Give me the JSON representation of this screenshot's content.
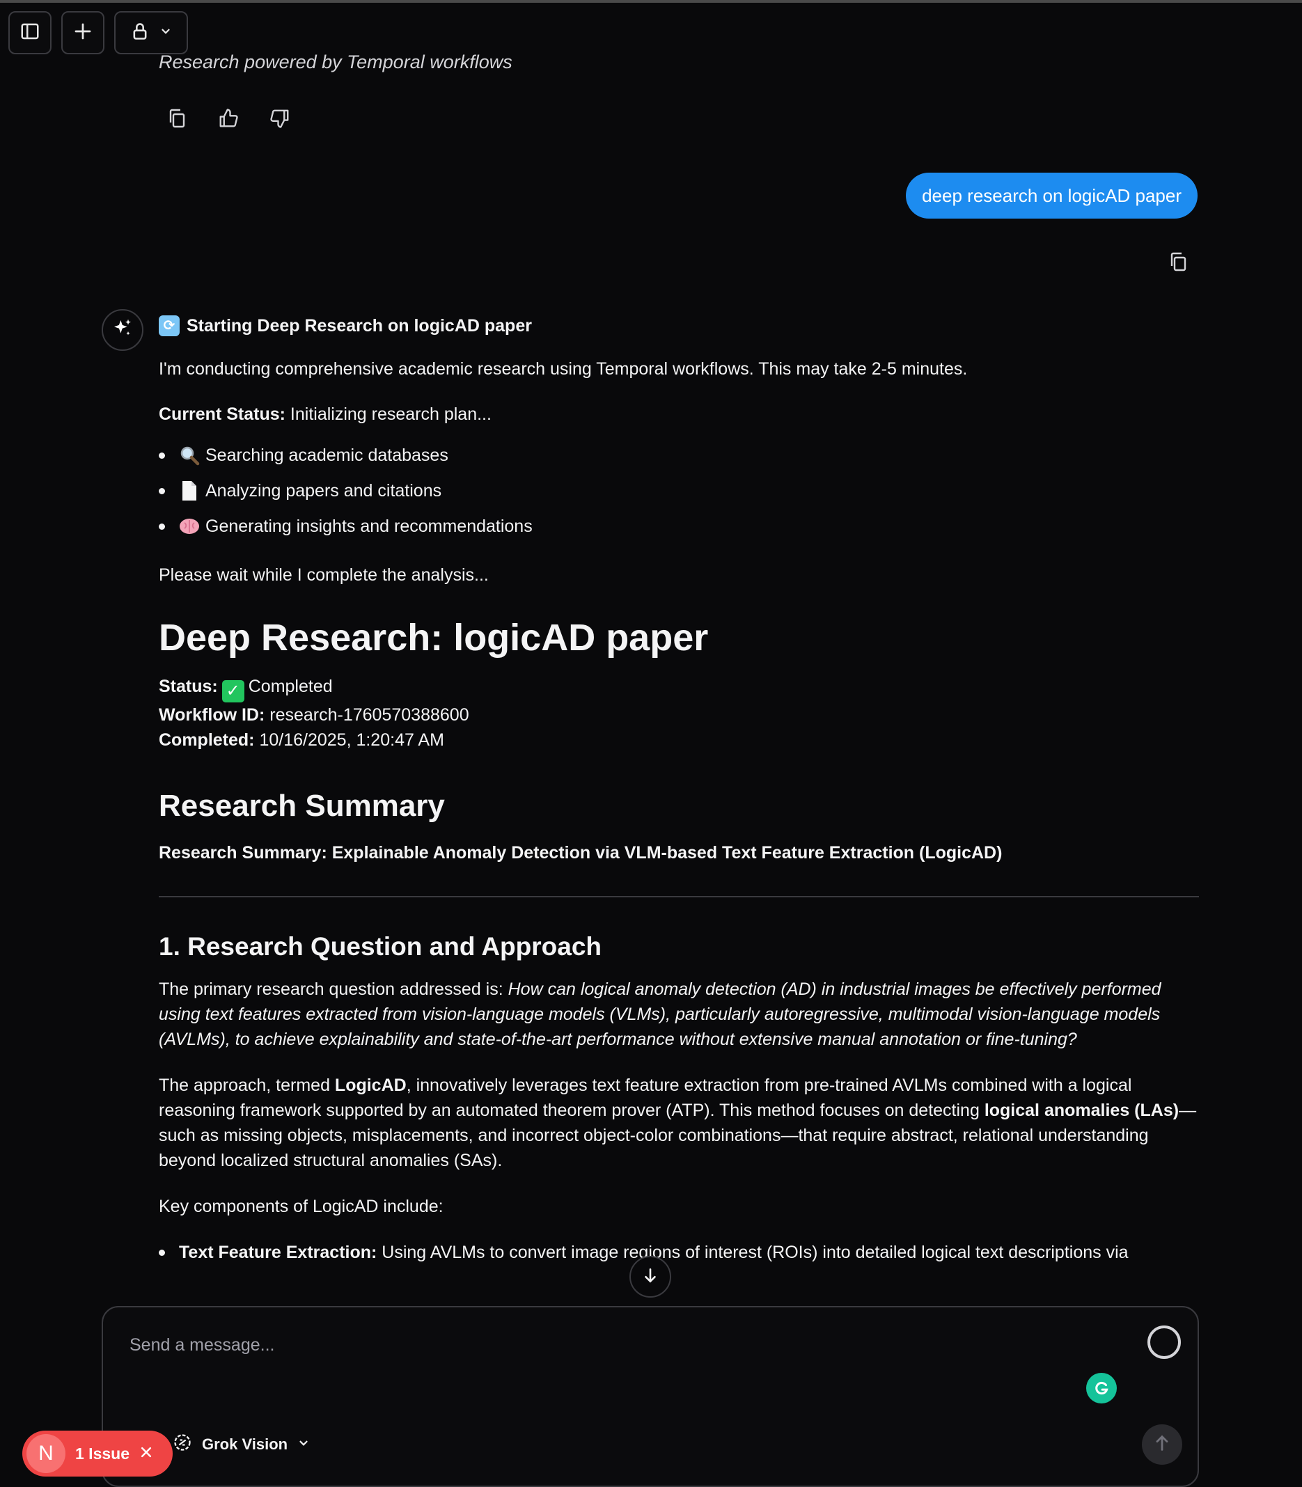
{
  "top_toolbar": {
    "sidebar_icon": "sidebar-toggle-icon",
    "new_chat_icon": "plus-icon",
    "lock_icon": "lock-icon",
    "chevron_icon": "chevron-down-icon"
  },
  "previous_message": {
    "footer_text": "Research powered by Temporal workflows",
    "actions": [
      "copy-icon",
      "thumbs-up-icon",
      "thumbs-down-icon"
    ]
  },
  "user_message": {
    "text": "deep research on logicAD paper",
    "bubble_color": "#1d8cf0"
  },
  "assistant_message": {
    "start_title": "Starting Deep Research on logicAD paper",
    "intro": "I'm conducting comprehensive academic research using Temporal workflows. This may take 2-5 minutes.",
    "current_status_label": "Current Status:",
    "current_status_value": " Initializing research plan...",
    "steps": [
      {
        "icon": "magnifier-icon",
        "text": "Searching academic databases"
      },
      {
        "icon": "document-icon",
        "text": "Analyzing papers and citations"
      },
      {
        "icon": "brain-icon",
        "text": "Generating insights and recommendations"
      }
    ],
    "wait_text": "Please wait while I complete the analysis...",
    "report_title": "Deep Research: logicAD paper",
    "status_label": "Status:",
    "status_value": "Completed",
    "workflow_label": "Workflow ID:",
    "workflow_value": " research-1760570388600",
    "completed_label": "Completed:",
    "completed_value": " 10/16/2025, 1:20:47 AM",
    "summary_heading": "Research Summary",
    "summary_subtitle": "Research Summary: Explainable Anomaly Detection via VLM-based Text Feature Extraction (LogicAD)",
    "section1_heading": "1. Research Question and Approach",
    "q_prefix": "The primary research question addressed is: ",
    "q_italic": "How can logical anomaly detection (AD) in industrial images be effectively performed using text features extracted from vision-language models (VLMs), particularly autoregressive, multimodal vision-language models (AVLMs), to achieve explainability and state-of-the-art performance without extensive manual annotation or fine-tuning?",
    "approach_1": "The approach, termed ",
    "approach_bold1": "LogicAD",
    "approach_2": ", innovatively leverages text feature extraction from pre-trained AVLMs combined with a logical reasoning framework supported by an automated theorem prover (ATP). This method focuses on detecting ",
    "approach_bold2": "logical anomalies (LAs)",
    "approach_3": "—such as missing objects, misplacements, and incorrect object-color combinations—that require abstract, relational understanding beyond localized structural anomalies (SAs).",
    "key_components": "Key components of LogicAD include:",
    "component_1_label": "Text Feature Extraction:",
    "component_1_text": " Using AVLMs to convert image regions of interest (ROIs) into detailed logical text descriptions via"
  },
  "composer": {
    "placeholder": "Send a message...",
    "model_name": "Grok Vision",
    "send_icon": "arrow-up-icon"
  },
  "issue_badge": {
    "initial": "N",
    "label": "1 Issue",
    "color": "#ef4444"
  }
}
